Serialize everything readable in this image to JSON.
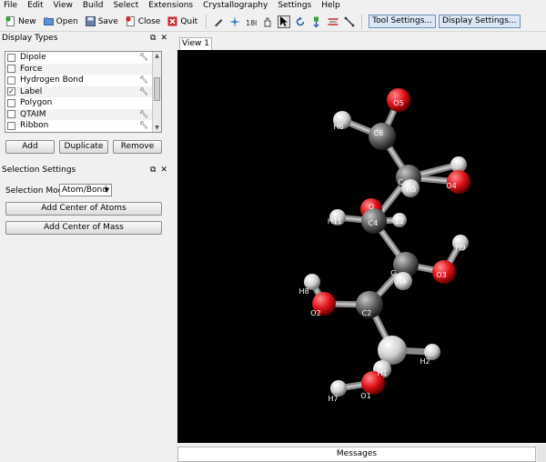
{
  "menu": [
    "File",
    "Edit",
    "View",
    "Build",
    "Select",
    "Extensions",
    "Crystallography",
    "Settings",
    "Help"
  ],
  "toolbar": {
    "new_label": "New",
    "open_label": "Open",
    "save_label": "Save",
    "close_label": "Close",
    "quit_label": "Quit",
    "tool_settings": "Tool Settings...",
    "display_settings": "Display Settings..."
  },
  "display_types": {
    "title": "Display Types",
    "items": [
      {
        "label": "Dipole",
        "checked": false,
        "settings": true
      },
      {
        "label": "Force",
        "checked": false,
        "settings": false
      },
      {
        "label": "Hydrogen Bond",
        "checked": false,
        "settings": true
      },
      {
        "label": "Label",
        "checked": true,
        "settings": true
      },
      {
        "label": "Polygon",
        "checked": false,
        "settings": false
      },
      {
        "label": "QTAIM",
        "checked": false,
        "settings": true
      },
      {
        "label": "Ribbon",
        "checked": false,
        "settings": true
      }
    ],
    "add": "Add",
    "duplicate": "Duplicate",
    "remove": "Remove"
  },
  "selection_settings": {
    "title": "Selection Settings",
    "mode_label": "Selection Mode:",
    "mode_value": "Atom/Bond",
    "add_center_atoms": "Add Center of Atoms",
    "add_center_mass": "Add Center of Mass"
  },
  "view": {
    "tab_label": "View 1",
    "messages_label": "Messages",
    "atom_colors": {
      "carbon": "#6e6e6e",
      "oxygen": "#e0141a",
      "hydrogen": "#e6e6e6"
    },
    "atoms": [
      {
        "label": "O5",
        "el": "O"
      },
      {
        "label": "H6",
        "el": "H"
      },
      {
        "label": "C6",
        "el": "C"
      },
      {
        "label": "C",
        "el": "C"
      },
      {
        "label": "H",
        "el": "H"
      },
      {
        "label": "H5",
        "el": "H"
      },
      {
        "label": "O4",
        "el": "O"
      },
      {
        "label": "O",
        "el": "O"
      },
      {
        "label": "H11",
        "el": "H"
      },
      {
        "label": "C4",
        "el": "C"
      },
      {
        "label": "12",
        "el": "H"
      },
      {
        "label": "H9",
        "el": "H"
      },
      {
        "label": "C",
        "el": "C"
      },
      {
        "label": "H4",
        "el": "H"
      },
      {
        "label": "O3",
        "el": "O"
      },
      {
        "label": "H8",
        "el": "H"
      },
      {
        "label": "O2",
        "el": "O"
      },
      {
        "label": "C2",
        "el": "C"
      },
      {
        "label": "H2",
        "el": "H"
      },
      {
        "label": "H1",
        "el": "H"
      },
      {
        "label": "H7",
        "el": "H"
      },
      {
        "label": "O1",
        "el": "O"
      }
    ]
  }
}
